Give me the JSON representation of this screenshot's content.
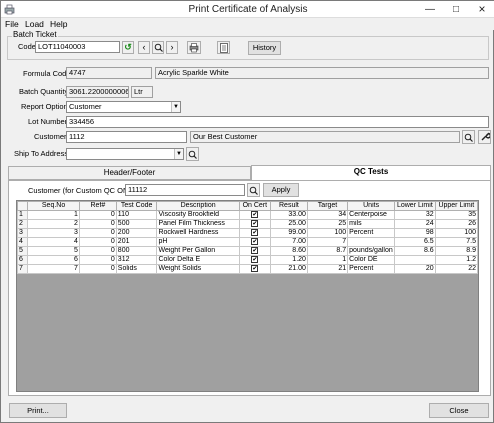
{
  "window": {
    "title": "Print Certificate of Analysis"
  },
  "menu": [
    "File",
    "Load",
    "Help"
  ],
  "batch_ticket": {
    "group_label": "Batch Ticket",
    "code_label": "Code",
    "code_value": "LOT11040003",
    "history_label": "History"
  },
  "formula": {
    "label": "Formula Code",
    "code": "4747",
    "name": "Acrylic Sparkle White"
  },
  "batch_quantity": {
    "label": "Batch Quantity",
    "value": "3061.2200000006",
    "unit": "Ltr"
  },
  "report_option": {
    "label": "Report Option",
    "value": "Customer"
  },
  "lot_number": {
    "label": "Lot Number",
    "value": "334456"
  },
  "customer": {
    "label": "Customer",
    "code": "1112",
    "name": "Our Best Customer"
  },
  "ship_to": {
    "label": "Ship To Address",
    "value": ""
  },
  "tabs": {
    "header_footer": "Header/Footer",
    "qc_tests": "QC Tests"
  },
  "custom_qc": {
    "label": "Customer (for Custom QC ONLY)",
    "value": "11112",
    "apply_label": "Apply"
  },
  "grid": {
    "columns": [
      "Seq.No",
      "Ref#",
      "Test Code",
      "Description",
      "On Cert",
      "Result",
      "Target",
      "Units",
      "Lower Limit",
      "Upper Limit"
    ],
    "rows": [
      [
        "1",
        "1",
        "0",
        "110",
        "Viscosity Brookfield",
        true,
        "33.00",
        "34",
        "Centerpoise",
        "32",
        "35"
      ],
      [
        "2",
        "2",
        "0",
        "500",
        "Panel Film Thickness",
        true,
        "25.00",
        "25",
        "mils",
        "24",
        "26"
      ],
      [
        "3",
        "3",
        "0",
        "200",
        "Rockwell Hardness",
        true,
        "99.00",
        "100",
        "Percent",
        "98",
        "100"
      ],
      [
        "4",
        "4",
        "0",
        "201",
        "pH",
        true,
        "7.00",
        "7",
        "",
        "6.5",
        "7.5"
      ],
      [
        "5",
        "5",
        "0",
        "800",
        "Weight Per Gallon",
        true,
        "8.60",
        "8.7",
        "pounds/gallon",
        "8.6",
        "8.9"
      ],
      [
        "6",
        "6",
        "0",
        "312",
        "Color Delta E",
        true,
        "1.20",
        "1",
        "Color DE",
        "",
        "1.2"
      ],
      [
        "7",
        "7",
        "0",
        "Solids",
        "Weight Solids",
        true,
        "21.00",
        "21",
        "Percent",
        "20",
        "22"
      ]
    ]
  },
  "footer": {
    "print_label": "Print...",
    "close_label": "Close"
  }
}
